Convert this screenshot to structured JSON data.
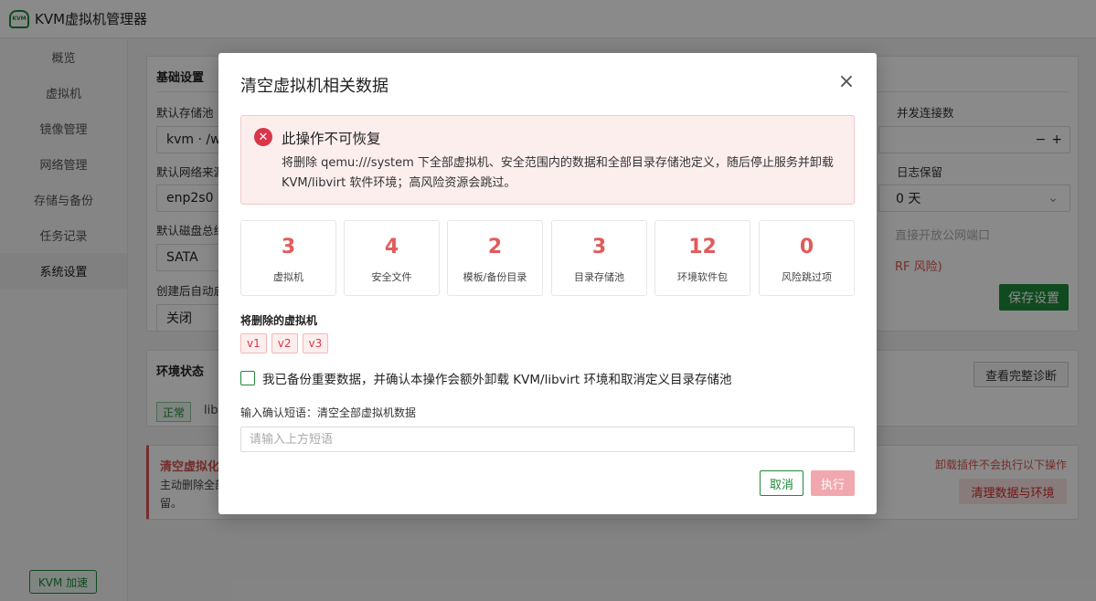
{
  "app": {
    "title": "KVM虚拟机管理器",
    "logo_text": "KVM"
  },
  "sidebar": {
    "items": [
      {
        "label": "概览"
      },
      {
        "label": "虚拟机"
      },
      {
        "label": "镜像管理"
      },
      {
        "label": "网络管理"
      },
      {
        "label": "存储与备份"
      },
      {
        "label": "任务记录"
      },
      {
        "label": "系统设置"
      }
    ],
    "accel_label": "KVM 加速"
  },
  "settings": {
    "title": "基础设置",
    "default_pool_label": "默认存储池",
    "default_pool_value": "kvm · /w",
    "default_net_label": "默认网络来源",
    "default_net_value": "enp2s0 ·",
    "default_bus_label": "默认磁盘总线",
    "default_bus_value": "SATA",
    "autostart_label": "创建后自动启",
    "autostart_value": "关闭",
    "concurrency_label": "并发连接数",
    "log_label": "日志保留",
    "log_value": "0 天",
    "port_text": "直接开放公网端口",
    "risk_text": "RF 风险)",
    "save_label": "保存设置"
  },
  "env": {
    "title": "环境状态",
    "diag_label": "查看完整诊断",
    "status_tag": "正常",
    "status_text": "lib"
  },
  "danger": {
    "title": "清空虚拟化",
    "desc_line1": "主动删除全部",
    "desc_line2": "留。",
    "note": "卸载插件不会执行以下操作",
    "clean_label": "清理数据与环境"
  },
  "modal": {
    "title": "清空虚拟机相关数据",
    "alert_title": "此操作不可恢复",
    "alert_body": "将删除 qemu:///system 下全部虚拟机、安全范围内的数据和全部目录存储池定义，随后停止服务并卸载 KVM/libvirt 软件环境；高风险资源会跳过。",
    "stats": [
      {
        "value": "3",
        "label": "虚拟机"
      },
      {
        "value": "4",
        "label": "安全文件"
      },
      {
        "value": "2",
        "label": "模板/备份目录"
      },
      {
        "value": "3",
        "label": "目录存储池"
      },
      {
        "value": "12",
        "label": "环境软件包"
      },
      {
        "value": "0",
        "label": "风险跳过项"
      }
    ],
    "vm_heading": "将删除的虚拟机",
    "vms": [
      "v1",
      "v2",
      "v3"
    ],
    "confirm_text": "我已备份重要数据，并确认本操作会额外卸载 KVM/libvirt 环境和取消定义目录存储池",
    "phrase_label": "输入确认短语：清空全部虚拟机数据",
    "phrase_placeholder": "请输入上方短语",
    "phrase_value": "",
    "cancel_label": "取消",
    "exec_label": "执行"
  },
  "colors": {
    "accent": "#1f8a3a",
    "danger": "#d9364a",
    "stat_value": "#e15b5b",
    "exec_disabled": "#f1a7ae"
  }
}
